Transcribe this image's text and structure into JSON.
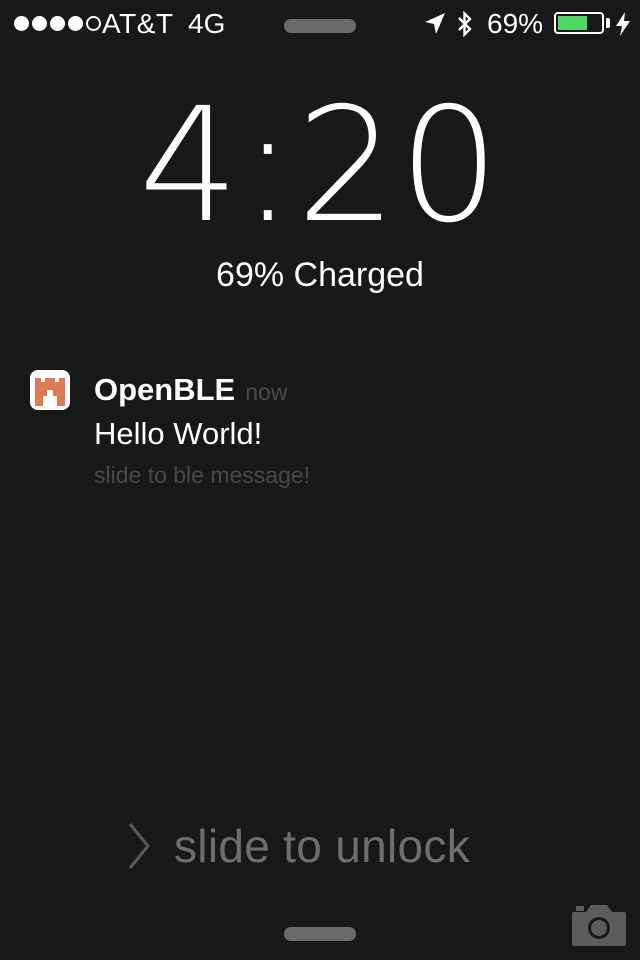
{
  "status_bar": {
    "signal_bars_filled": 4,
    "signal_bars_total": 5,
    "carrier": "AT&T",
    "network": "4G",
    "battery_percent_label": "69%",
    "battery_level": 0.69,
    "icons": [
      "location-arrow-icon",
      "bluetooth-icon",
      "battery-icon",
      "charging-bolt-icon"
    ]
  },
  "lock_screen": {
    "time": "4:20",
    "charge_status": "69% Charged"
  },
  "notification": {
    "app_name": "OpenBLE",
    "time": "now",
    "message": "Hello World!",
    "action_hint": "slide to ble message!",
    "icon": "openble-app-icon"
  },
  "unlock": {
    "label": "slide to unlock",
    "icon": "chevron-right-icon"
  },
  "camera": {
    "icon": "camera-icon"
  },
  "colors": {
    "background": "#181818",
    "battery_fill": "#4cd964",
    "app_icon_accent": "#e07a53",
    "muted_text": "#6e6e6e"
  }
}
